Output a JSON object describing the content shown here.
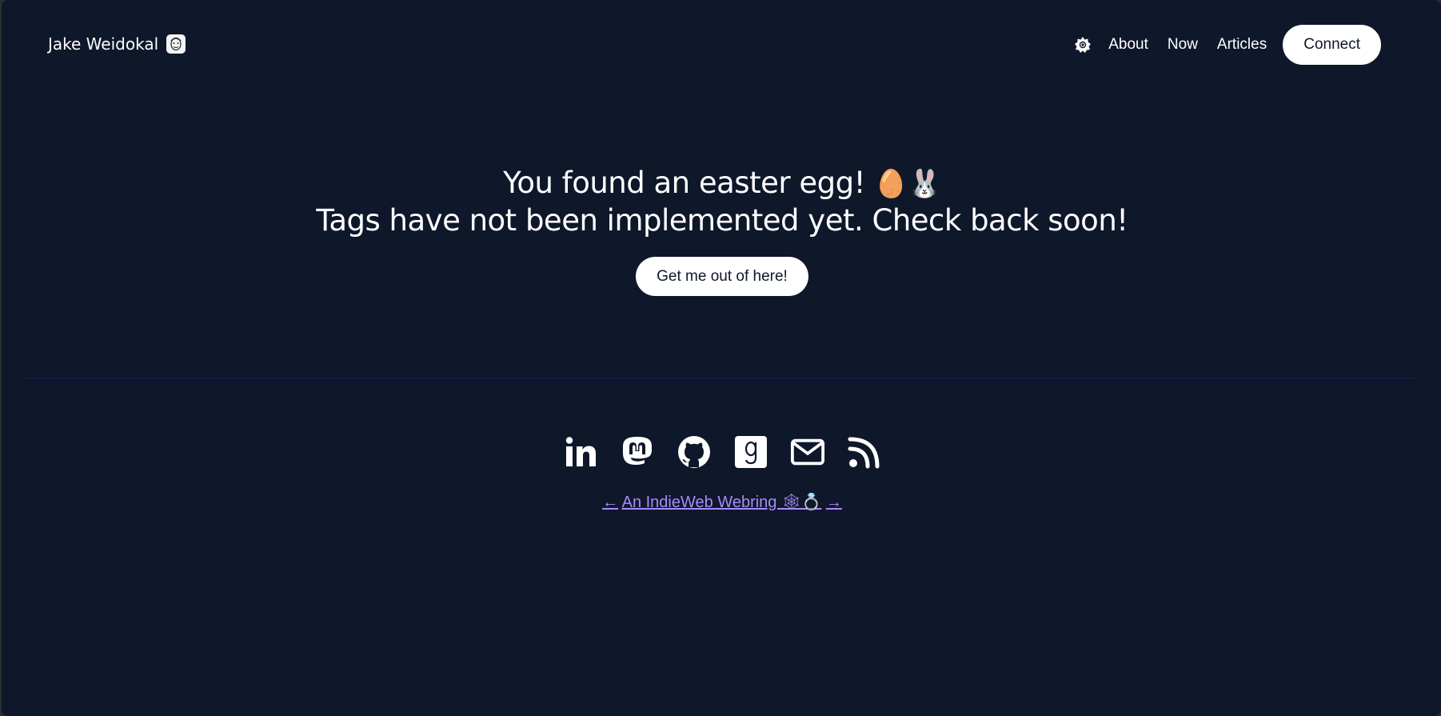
{
  "header": {
    "brand_name": "Jake Weidokal",
    "brand_avatar_icon": "portrait-sketch-icon",
    "theme_toggle_icon": "sun-icon",
    "nav": [
      {
        "label": "About"
      },
      {
        "label": "Now"
      },
      {
        "label": "Articles"
      }
    ],
    "connect_label": "Connect"
  },
  "hero": {
    "line1": "You found an easter egg!",
    "line1_emoji": "🥚🐰",
    "line2": "Tags have not been implemented yet. Check back soon!",
    "button_label": "Get me out of here!"
  },
  "footer": {
    "socials": [
      {
        "name": "LinkedIn",
        "icon": "linkedin-icon"
      },
      {
        "name": "Mastodon",
        "icon": "mastodon-icon"
      },
      {
        "name": "GitHub",
        "icon": "github-icon"
      },
      {
        "name": "Goodreads",
        "icon": "goodreads-icon"
      },
      {
        "name": "Email",
        "icon": "envelope-icon"
      },
      {
        "name": "RSS",
        "icon": "rss-icon"
      }
    ],
    "webring": {
      "prev": "←",
      "label": "An IndieWeb Webring 🕸💍",
      "next": "→"
    }
  },
  "colors": {
    "background": "#0f172a",
    "text": "#ffffff",
    "link": "#a78bfa",
    "divider": "#2e1065"
  }
}
